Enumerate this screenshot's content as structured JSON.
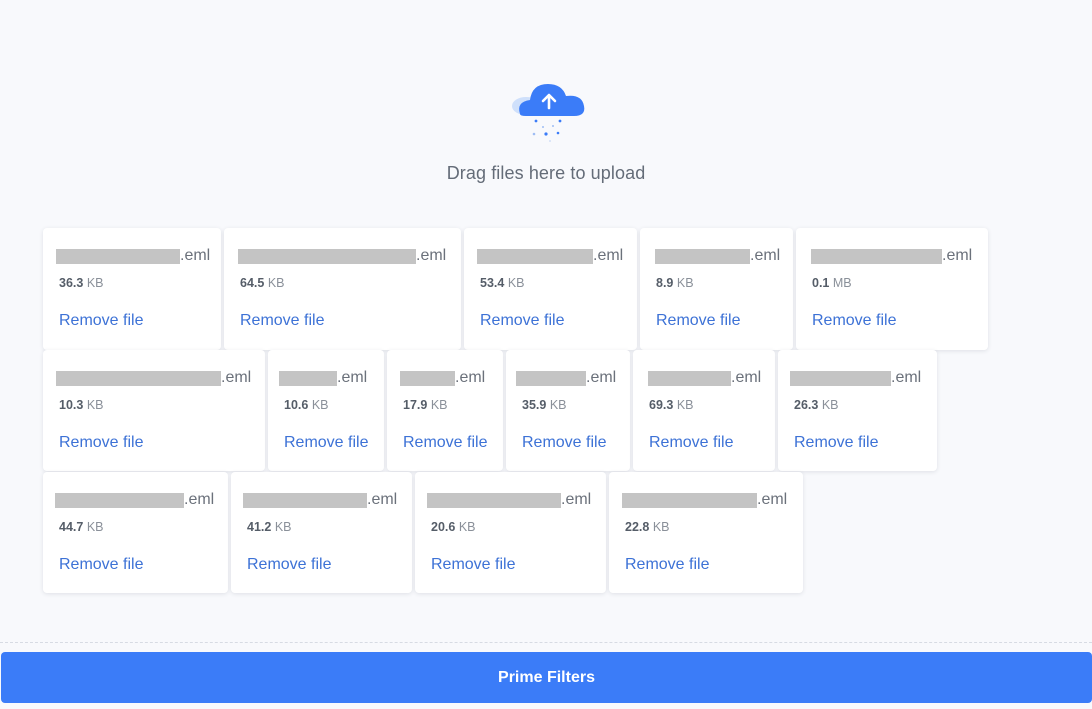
{
  "dropzone": {
    "message": "Drag files here to upload",
    "icon": "cloud-upload-icon",
    "accent_color": "#3b7cf8"
  },
  "files": [
    {
      "ext": ".eml",
      "size_value": "36.3",
      "size_unit": "KB",
      "remove_label": "Remove file"
    },
    {
      "ext": ".eml",
      "size_value": "64.5",
      "size_unit": "KB",
      "remove_label": "Remove file"
    },
    {
      "ext": ".eml",
      "size_value": "53.4",
      "size_unit": "KB",
      "remove_label": "Remove file"
    },
    {
      "ext": ".eml",
      "size_value": "8.9",
      "size_unit": "KB",
      "remove_label": "Remove file"
    },
    {
      "ext": ".eml",
      "size_value": "0.1",
      "size_unit": "MB",
      "remove_label": "Remove file"
    },
    {
      "ext": ".eml",
      "size_value": "10.3",
      "size_unit": "KB",
      "remove_label": "Remove file"
    },
    {
      "ext": ".eml",
      "size_value": "10.6",
      "size_unit": "KB",
      "remove_label": "Remove file"
    },
    {
      "ext": ".eml",
      "size_value": "17.9",
      "size_unit": "KB",
      "remove_label": "Remove file"
    },
    {
      "ext": ".eml",
      "size_value": "35.9",
      "size_unit": "KB",
      "remove_label": "Remove file"
    },
    {
      "ext": ".eml",
      "size_value": "69.3",
      "size_unit": "KB",
      "remove_label": "Remove file"
    },
    {
      "ext": ".eml",
      "size_value": "26.3",
      "size_unit": "KB",
      "remove_label": "Remove file"
    },
    {
      "ext": ".eml",
      "size_value": "44.7",
      "size_unit": "KB",
      "remove_label": "Remove file"
    },
    {
      "ext": ".eml",
      "size_value": "41.2",
      "size_unit": "KB",
      "remove_label": "Remove file"
    },
    {
      "ext": ".eml",
      "size_value": "20.6",
      "size_unit": "KB",
      "remove_label": "Remove file"
    },
    {
      "ext": ".eml",
      "size_value": "22.8",
      "size_unit": "KB",
      "remove_label": "Remove file"
    }
  ],
  "action": {
    "label": "Prime Filters"
  }
}
